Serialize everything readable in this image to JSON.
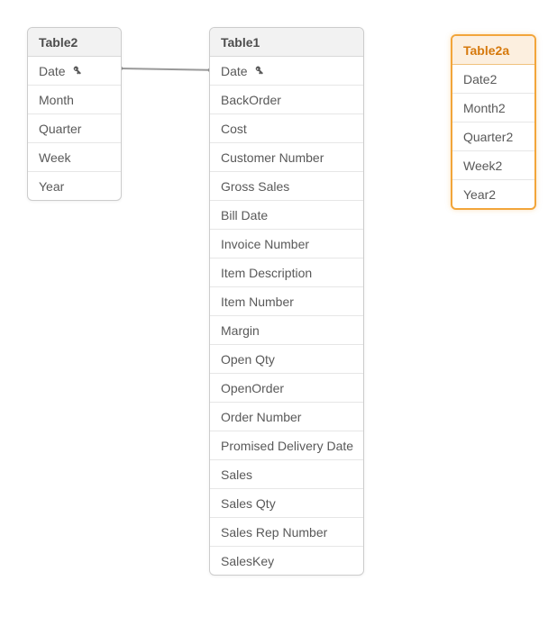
{
  "tables": {
    "table2": {
      "title": "Table2",
      "fields": [
        {
          "label": "Date",
          "is_key": true
        },
        {
          "label": "Month",
          "is_key": false
        },
        {
          "label": "Quarter",
          "is_key": false
        },
        {
          "label": "Week",
          "is_key": false
        },
        {
          "label": "Year",
          "is_key": false
        }
      ]
    },
    "table1": {
      "title": "Table1",
      "fields": [
        {
          "label": "Date",
          "is_key": true
        },
        {
          "label": "BackOrder",
          "is_key": false
        },
        {
          "label": "Cost",
          "is_key": false
        },
        {
          "label": "Customer Number",
          "is_key": false
        },
        {
          "label": "Gross Sales",
          "is_key": false
        },
        {
          "label": "Bill Date",
          "is_key": false
        },
        {
          "label": "Invoice Number",
          "is_key": false
        },
        {
          "label": "Item Description",
          "is_key": false
        },
        {
          "label": "Item Number",
          "is_key": false
        },
        {
          "label": "Margin",
          "is_key": false
        },
        {
          "label": "Open Qty",
          "is_key": false
        },
        {
          "label": "OpenOrder",
          "is_key": false
        },
        {
          "label": "Order Number",
          "is_key": false
        },
        {
          "label": "Promised Delivery Date",
          "is_key": false
        },
        {
          "label": "Sales",
          "is_key": false
        },
        {
          "label": "Sales Qty",
          "is_key": false
        },
        {
          "label": "Sales Rep Number",
          "is_key": false
        },
        {
          "label": "SalesKey",
          "is_key": false
        }
      ]
    },
    "table2a": {
      "title": "Table2a",
      "highlighted": true,
      "fields": [
        {
          "label": "Date2",
          "is_key": false
        },
        {
          "label": "Month2",
          "is_key": false
        },
        {
          "label": "Quarter2",
          "is_key": false
        },
        {
          "label": "Week2",
          "is_key": false
        },
        {
          "label": "Year2",
          "is_key": false
        }
      ]
    }
  },
  "connections": [
    {
      "from": "table2.Date",
      "to": "table1.Date"
    }
  ]
}
